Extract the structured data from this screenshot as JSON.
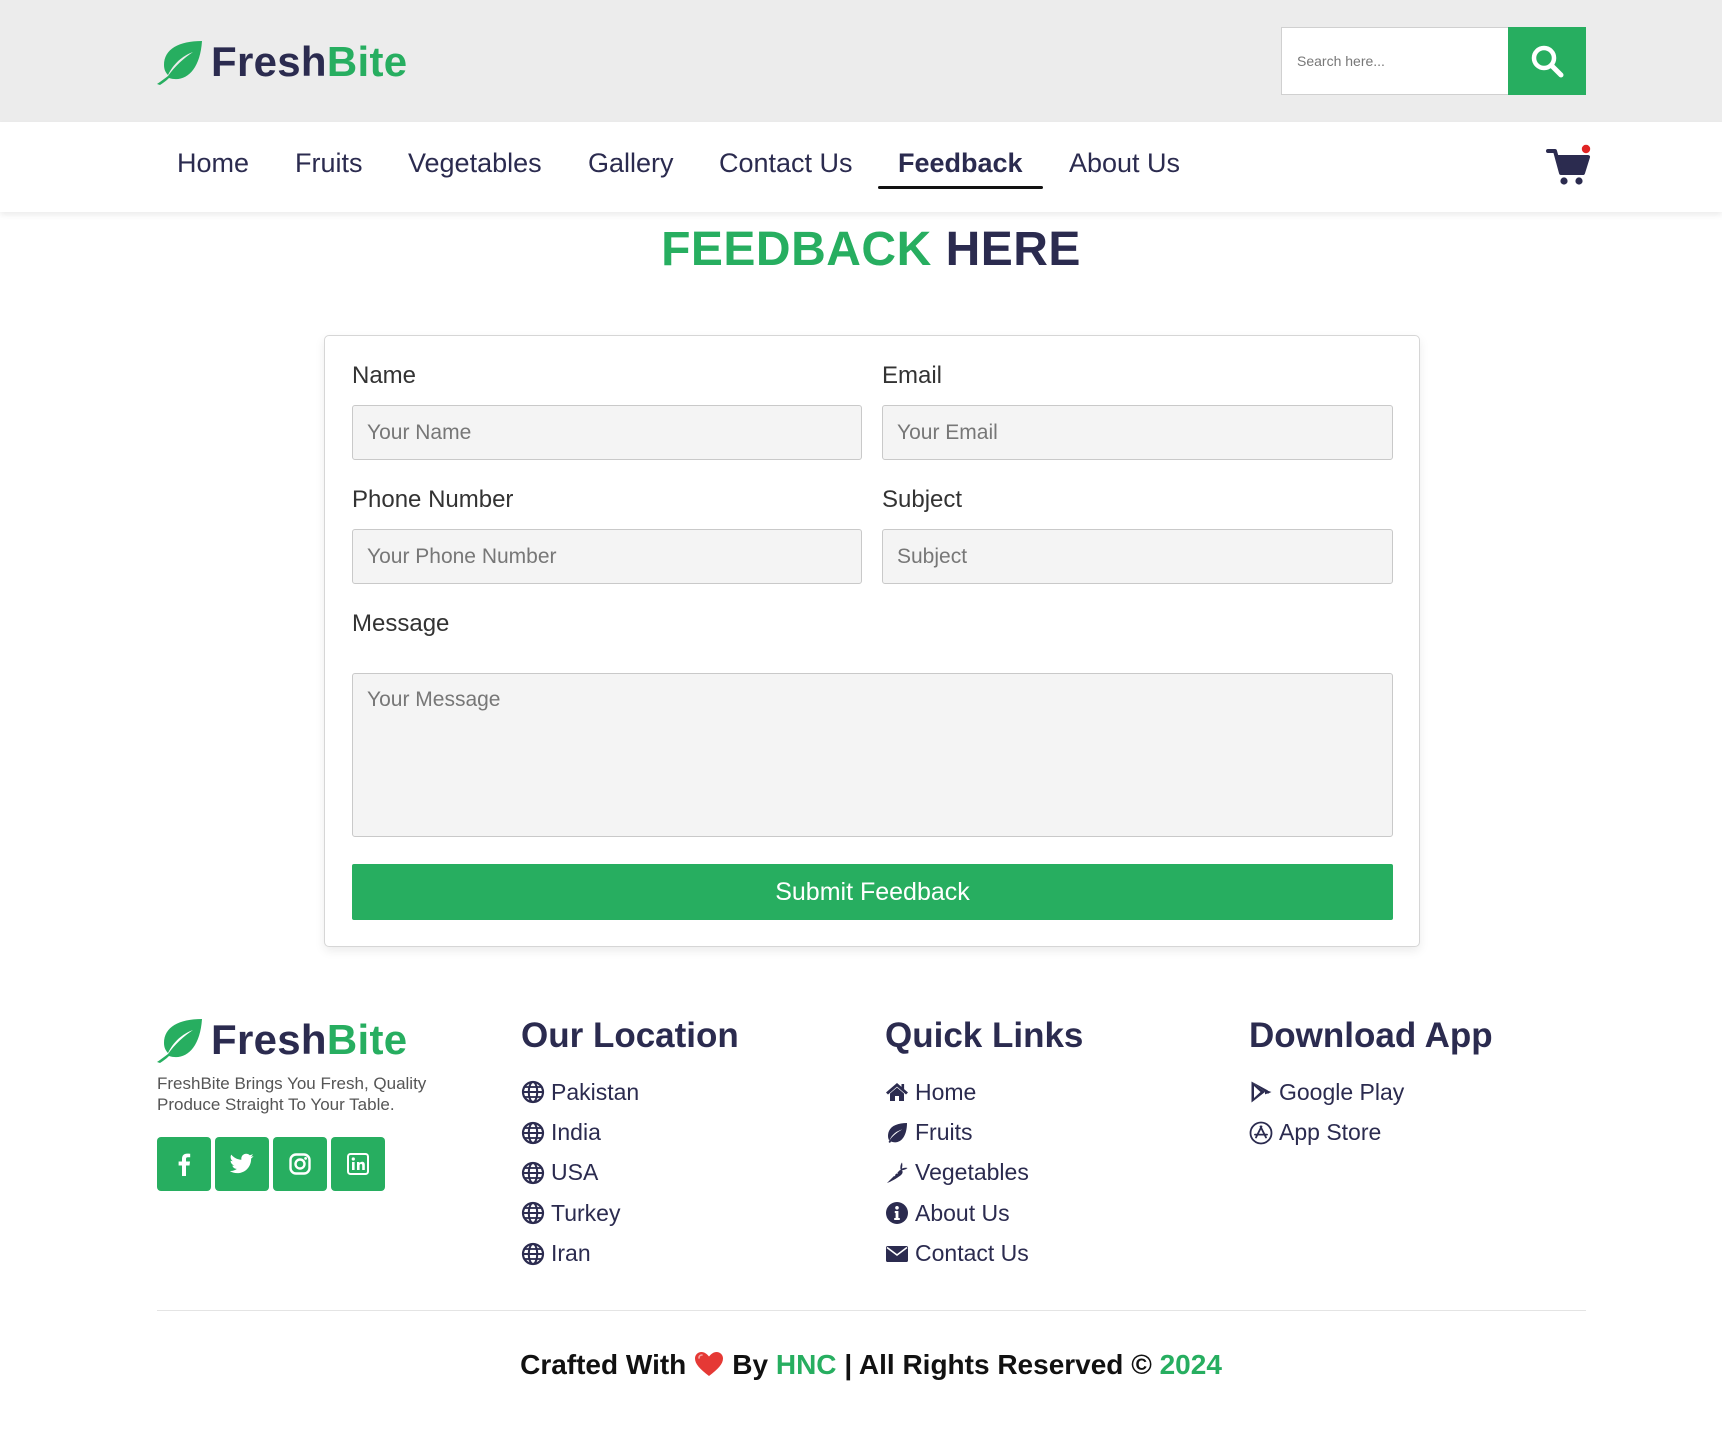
{
  "brand": {
    "part1": "Fresh",
    "part2": "Bite"
  },
  "search": {
    "placeholder": "Search here..."
  },
  "nav": {
    "items": [
      "Home",
      "Fruits",
      "Vegetables",
      "Gallery",
      "Contact Us",
      "Feedback",
      "About Us"
    ],
    "active": "Feedback"
  },
  "page": {
    "heading_green": "FEEDBACK",
    "heading_dark": "HERE"
  },
  "form": {
    "name_label": "Name",
    "name_placeholder": "Your Name",
    "name_value": "",
    "email_label": "Email",
    "email_placeholder": "Your Email",
    "email_value": "",
    "phone_label": "Phone Number",
    "phone_placeholder": "Your Phone Number",
    "phone_value": "",
    "subject_label": "Subject",
    "subject_placeholder": "Subject",
    "subject_value": "",
    "message_label": "Message",
    "message_placeholder": "Your Message",
    "message_value": "",
    "submit_label": "Submit Feedback"
  },
  "footer": {
    "tagline": "FreshBite Brings You Fresh, Quality Produce Straight To Your Table.",
    "socials": [
      "facebook-icon",
      "twitter-icon",
      "instagram-icon",
      "linkedin-icon"
    ],
    "location_title": "Our Location",
    "locations": [
      "Pakistan",
      "India",
      "USA",
      "Turkey",
      "Iran"
    ],
    "quick_title": "Quick Links",
    "quick_links": [
      {
        "label": "Home",
        "icon": "home-icon"
      },
      {
        "label": "Fruits",
        "icon": "leaf-icon"
      },
      {
        "label": "Vegetables",
        "icon": "carrot-icon"
      },
      {
        "label": "About Us",
        "icon": "info-icon"
      },
      {
        "label": "Contact Us",
        "icon": "envelope-icon"
      }
    ],
    "download_title": "Download App",
    "downloads": [
      {
        "label": "Google Play",
        "icon": "google-play-icon"
      },
      {
        "label": "App Store",
        "icon": "app-store-icon"
      }
    ],
    "credit": {
      "crafted": "Crafted With",
      "by": "By",
      "author": "HNC",
      "rights": "| All Rights Reserved ©",
      "year": "2024"
    }
  },
  "colors": {
    "accent": "#27ae60",
    "navy": "#2b2b4f",
    "topbar": "#ececec",
    "cart_dot": "#e02424",
    "heart": "#e53935"
  }
}
